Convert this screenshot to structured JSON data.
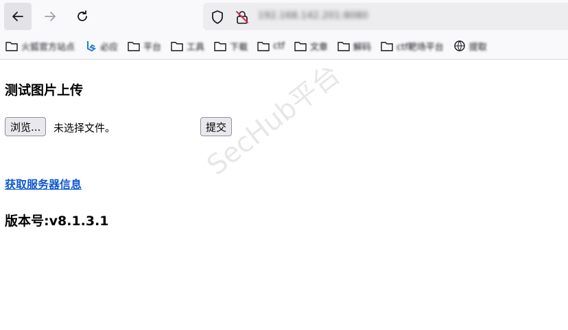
{
  "browser": {
    "url": "192.168.142.201:8080",
    "bookmarks": [
      {
        "label": "火狐官方站点",
        "icon": "folder-icon"
      },
      {
        "label": "必应",
        "icon": "bing-icon"
      },
      {
        "label": "平台",
        "icon": "folder-icon"
      },
      {
        "label": "工具",
        "icon": "folder-icon"
      },
      {
        "label": "下载",
        "icon": "folder-icon"
      },
      {
        "label": "ctf",
        "icon": "folder-icon"
      },
      {
        "label": "文章",
        "icon": "folder-icon"
      },
      {
        "label": "解码",
        "icon": "folder-icon"
      },
      {
        "label": "ctf靶场平台",
        "icon": "folder-icon"
      },
      {
        "label": "提取",
        "icon": "globe-icon"
      }
    ]
  },
  "page": {
    "title": "测试图片上传",
    "browse_label": "浏览...",
    "file_status": "未选择文件。",
    "submit_label": "提交",
    "server_link": "获取服务器信息",
    "version": "版本号:v8.1.3.1"
  },
  "watermark": "SecHub平台",
  "colors": {
    "link": "#0b57d0",
    "button_bg": "#e9e9ed"
  }
}
